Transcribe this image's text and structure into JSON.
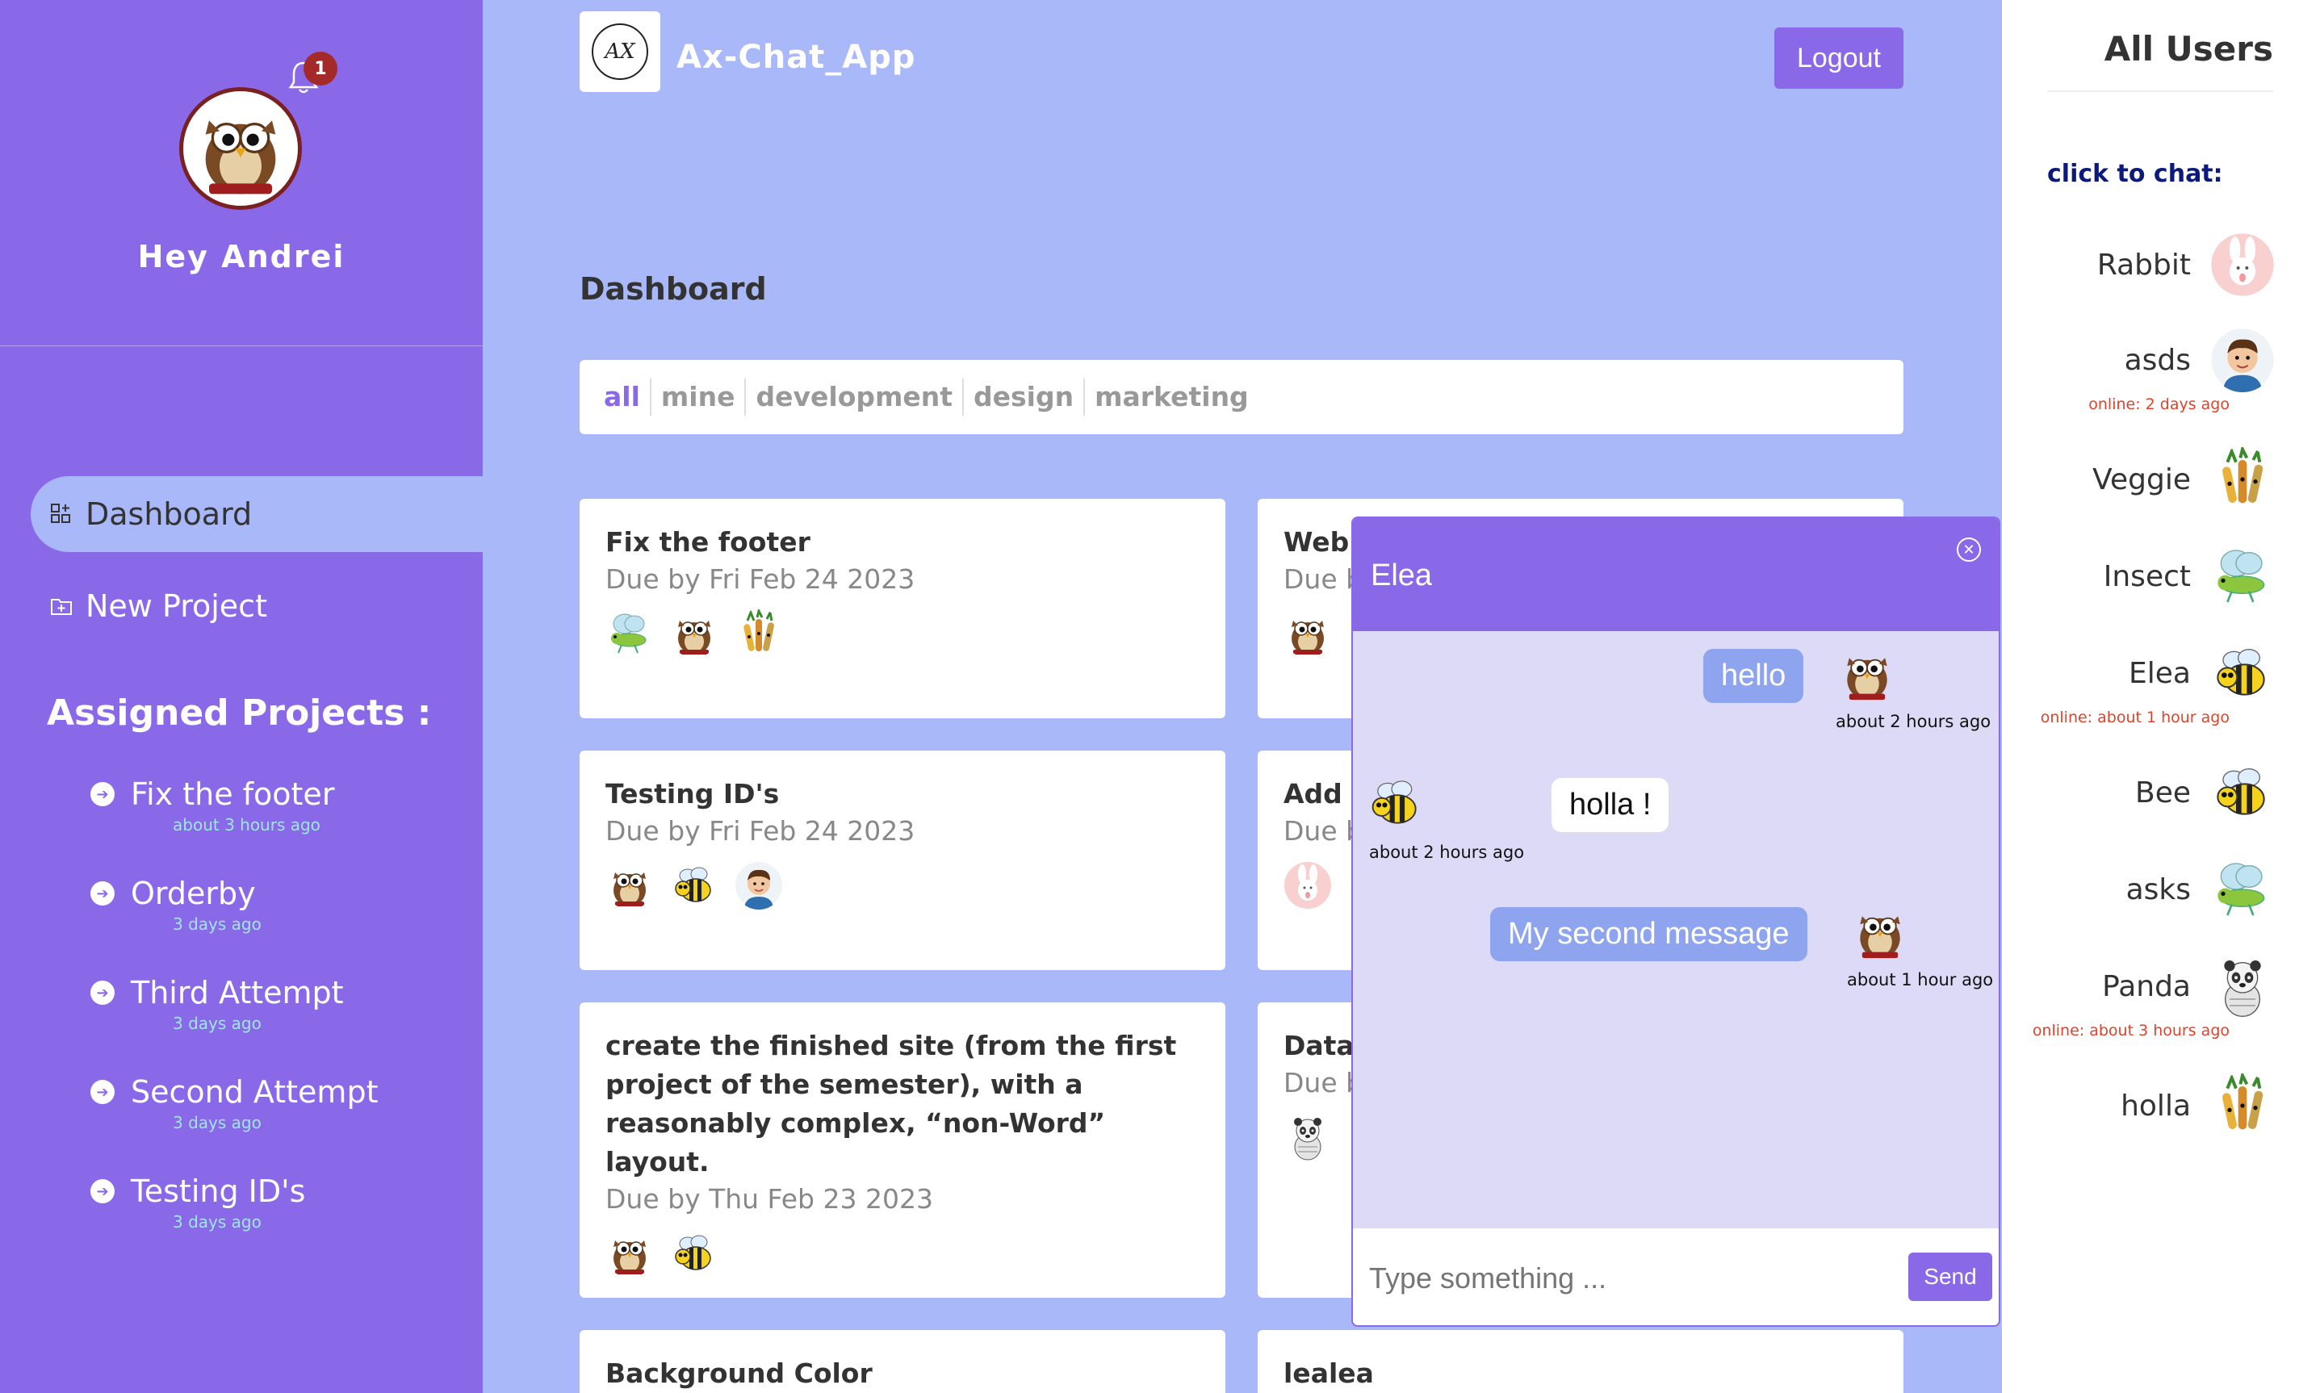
{
  "sidebar": {
    "notification_count": "1",
    "greeting": "Hey Andrei",
    "nav": [
      {
        "label": "Dashboard",
        "icon": "dashboard-icon"
      },
      {
        "label": "New Project",
        "icon": "folder-plus-icon"
      }
    ],
    "assigned_title": "Assigned Projects :",
    "projects": [
      {
        "name": "Fix the footer",
        "time": "about 3 hours ago"
      },
      {
        "name": "Orderby",
        "time": "3 days ago"
      },
      {
        "name": "Third Attempt",
        "time": "3 days ago"
      },
      {
        "name": "Second Attempt",
        "time": "3 days ago"
      },
      {
        "name": "Testing ID's",
        "time": "3 days ago"
      }
    ]
  },
  "header": {
    "app_title": "Ax-Chat_App",
    "logout_label": "Logout"
  },
  "main": {
    "title": "Dashboard",
    "filters": [
      "all",
      "mine",
      "development",
      "design",
      "marketing"
    ],
    "cards": [
      {
        "title": "Fix the footer",
        "due": "Due by Fri Feb 24 2023"
      },
      {
        "title": "Web",
        "due": "Due b"
      },
      {
        "title": "Testing ID's",
        "due": "Due by Fri Feb 24 2023"
      },
      {
        "title": "Add t",
        "due": "Due b"
      },
      {
        "title": "create the finished site (from the first project of the semester), with a reasonably complex, “non-Word” layout.",
        "due": "Due by Thu Feb 23 2023"
      },
      {
        "title": "Data",
        "due": "Due b"
      },
      {
        "title": "Background Color",
        "due": ""
      },
      {
        "title": "lealea",
        "due": ""
      }
    ]
  },
  "chat": {
    "recipient": "Elea",
    "messages": [
      {
        "text": "hello",
        "time": "about 2 hours ago",
        "mine": true
      },
      {
        "text": "holla !",
        "time": "about 2 hours ago",
        "mine": false
      },
      {
        "text": "My second message",
        "time": "about 1 hour ago",
        "mine": true
      }
    ],
    "input_placeholder": "Type something ...",
    "send_label": "Send"
  },
  "users": {
    "title": "All Users",
    "subtitle": "click to chat:",
    "list": [
      {
        "name": "Rabbit",
        "online": ""
      },
      {
        "name": "asds",
        "online": "online: 2 days ago"
      },
      {
        "name": "Veggie",
        "online": ""
      },
      {
        "name": "Insect",
        "online": ""
      },
      {
        "name": "Elea",
        "online": "online: about 1 hour ago"
      },
      {
        "name": "Bee",
        "online": ""
      },
      {
        "name": "asks",
        "online": ""
      },
      {
        "name": "Panda",
        "online": "online: about 3 hours ago"
      },
      {
        "name": "holla",
        "online": ""
      }
    ]
  },
  "colors": {
    "accent": "#8a69e8",
    "background": "#a8b8f8",
    "online_text": "#e0422a"
  }
}
